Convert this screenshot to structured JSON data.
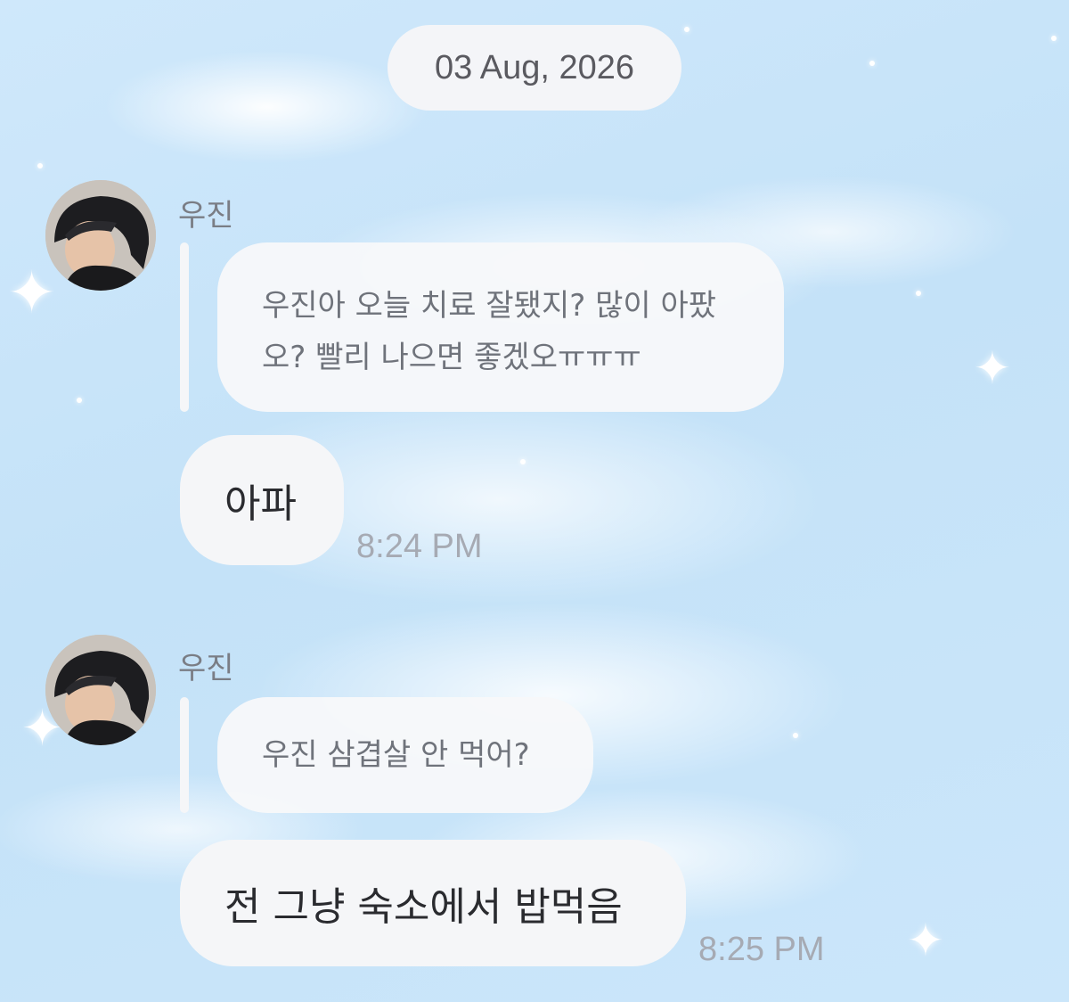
{
  "date_separator": "03 Aug, 2026",
  "messages": [
    {
      "sender": "우진",
      "avatar": "avatar-photo",
      "reply_quote": "우진아 오늘 치료 잘됐지? 많이 아팠오? 빨리 나으면 좋겠오ㅠㅠㅠ",
      "text": "아파",
      "time": "8:24 PM"
    },
    {
      "sender": "우진",
      "avatar": "avatar-photo",
      "reply_quote": "우진 삼겹살 안 먹어?",
      "text": "전 그냥 숙소에서 밥먹음",
      "time": "8:25 PM"
    }
  ],
  "colors": {
    "background": "#c4e2f8",
    "bubble": "#f5f6f8",
    "time_text": "#a6aab3",
    "sender_text": "#7a7d85"
  }
}
